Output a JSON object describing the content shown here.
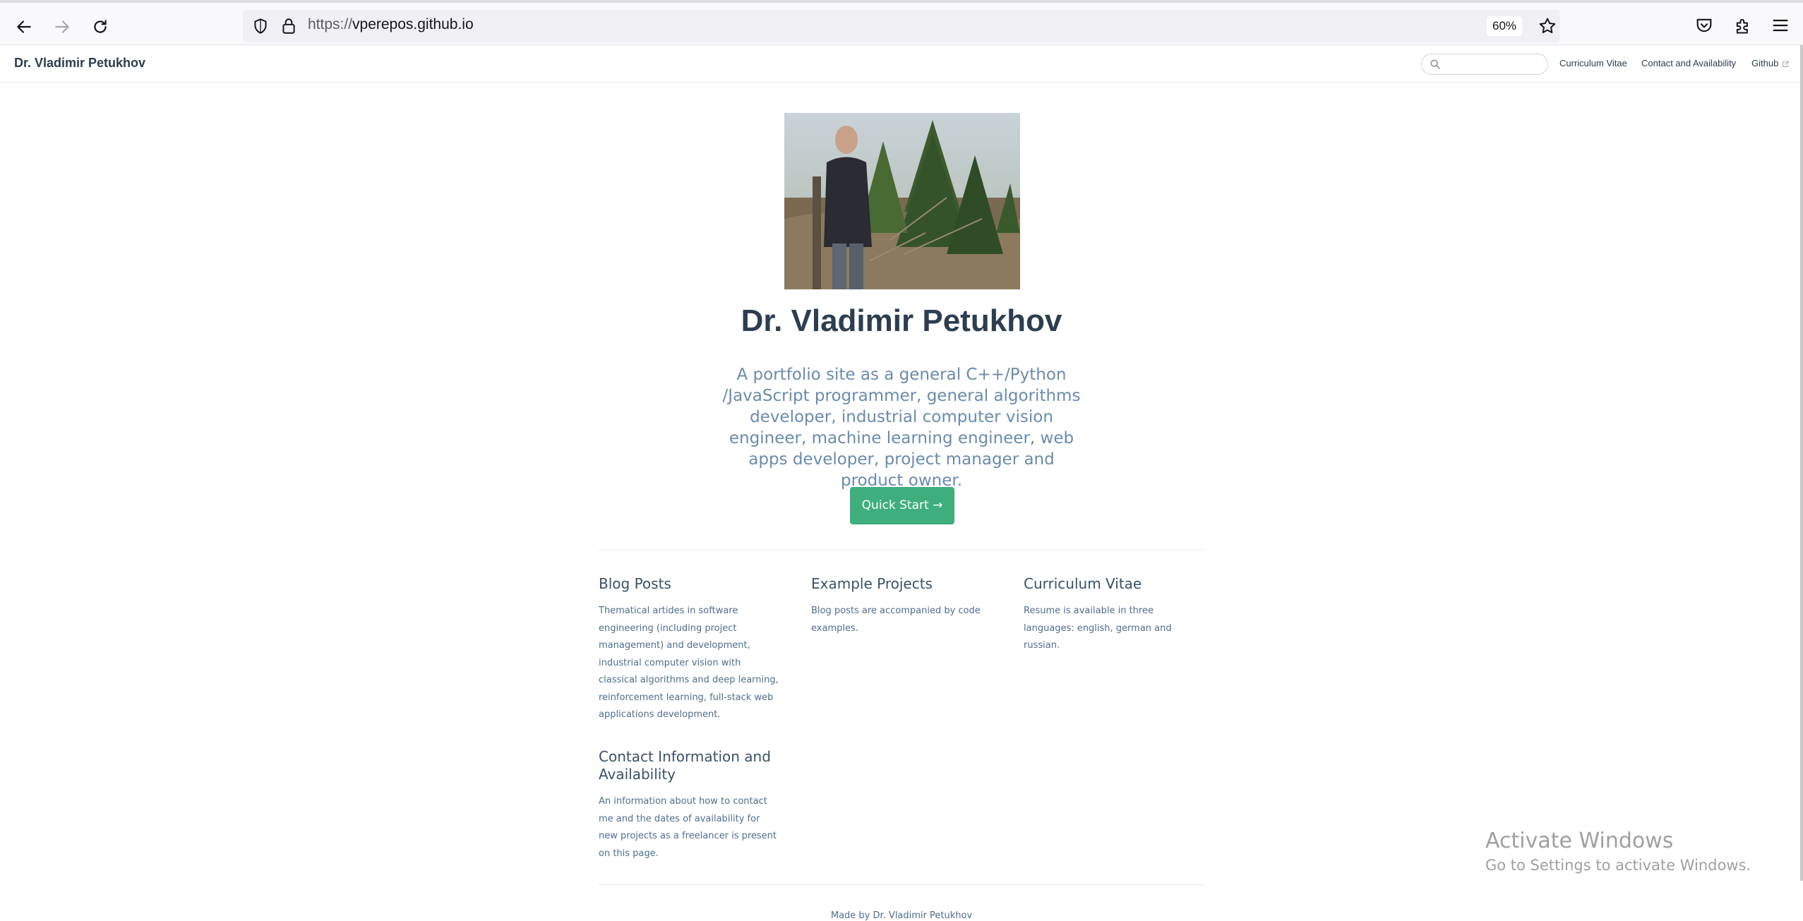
{
  "browser": {
    "url_protocol": "https://",
    "url_host": "vperepos.github.io",
    "zoom": "60%",
    "icons": {
      "back": "back-arrow-icon",
      "forward": "forward-arrow-icon",
      "reload": "reload-icon",
      "tracking": "shield-icon",
      "lock": "lock-icon",
      "bookmark": "star-icon",
      "pocket": "pocket-icon",
      "extensions": "puzzle-icon",
      "menu": "hamburger-menu-icon"
    }
  },
  "navbar": {
    "site_name": "Dr. Vladimir Petukhov",
    "search_placeholder": "",
    "links": [
      {
        "label": "Curriculum Vitae"
      },
      {
        "label": "Contact and Availability"
      },
      {
        "label": "Github"
      }
    ]
  },
  "hero": {
    "title": "Dr. Vladimir Petukhov",
    "description": "A portfolio site as a general C++/Python /JavaScript programmer, general algorithms developer, industrial computer vision engineer, machine learning engineer, web apps developer, project manager and product owner.",
    "cta_label": "Quick Start →"
  },
  "features": [
    {
      "title": "Blog Posts",
      "text": "Thematical artides in software engineering (including project management) and development, industrial computer vision with classical algorithms and deep learning, reinforcement learning, full-stack web applications development."
    },
    {
      "title": "Example Projects",
      "text": "Blog posts are accompanied by code examples."
    },
    {
      "title": "Curriculum Vitae",
      "text": "Resume is available in three languages: english, german and russian."
    },
    {
      "title": "Contact Information and Availability",
      "text": "An information about how to contact me and the dates of availability for new projects as a freelancer is present on this page."
    }
  ],
  "footer": {
    "text": "Made by Dr. Vladimir Petukhov"
  },
  "watermark": {
    "line1": "Activate Windows",
    "line2": "Go to Settings to activate Windows."
  },
  "colors": {
    "accent": "#3eaf7c",
    "text": "#2c3e50",
    "description": "#6a8bad"
  }
}
